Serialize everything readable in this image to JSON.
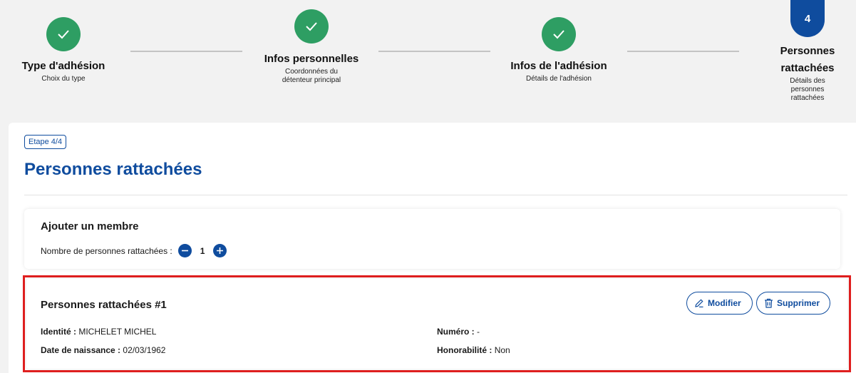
{
  "stepper": {
    "steps": [
      {
        "title": "Type d'adhésion",
        "subtitle": "Choix du type",
        "status": "done"
      },
      {
        "title": "Infos personnelles",
        "subtitle": "Coordonnées du détenteur principal",
        "status": "done"
      },
      {
        "title": "Infos de l'adhésion",
        "subtitle": "Détails de l'adhésion",
        "status": "done"
      },
      {
        "title": "Personnes rattachées",
        "subtitle": "Détails des personnes rattachées",
        "status": "active",
        "number": "4"
      }
    ],
    "icons": {
      "done": "check-icon"
    }
  },
  "page": {
    "step_badge": "Etape 4/4",
    "title": "Personnes rattachées"
  },
  "add_member": {
    "title": "Ajouter un membre",
    "count_label": "Nombre de personnes rattachées :",
    "count": "1"
  },
  "member": {
    "title": "Personnes rattachées #1",
    "identite_label": "Identité :",
    "identite_value": "MICHELET MICHEL",
    "naissance_label": "Date de naissance :",
    "naissance_value": "02/03/1962",
    "numero_label": "Numéro :",
    "numero_value": "-",
    "honorabilite_label": "Honorabilité :",
    "honorabilite_value": "Non",
    "edit_label": "Modifier",
    "delete_label": "Supprimer"
  },
  "colors": {
    "primary": "#0f4c9e",
    "success": "#2e9e63",
    "highlight": "#e01f1f"
  }
}
